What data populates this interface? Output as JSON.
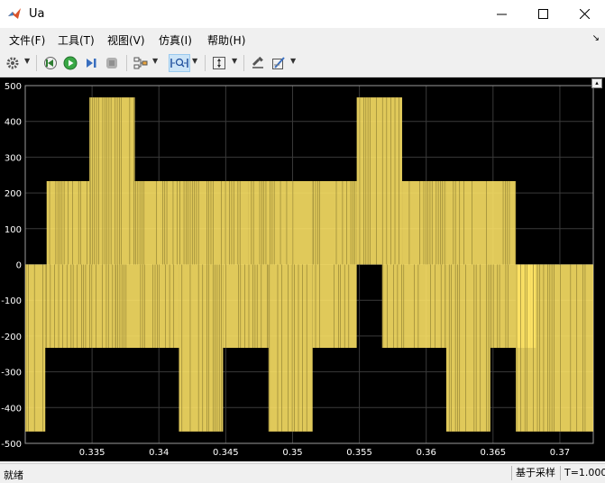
{
  "window": {
    "title": "Ua"
  },
  "menu": [
    {
      "label": "文件(F)",
      "name": "menu-file"
    },
    {
      "label": "工具(T)",
      "name": "menu-tools"
    },
    {
      "label": "视图(V)",
      "name": "menu-view"
    },
    {
      "label": "仿真(I)",
      "name": "menu-simulation"
    },
    {
      "label": "帮助(H)",
      "name": "menu-help"
    }
  ],
  "toolbar": {
    "icons": [
      "gear-icon",
      "step-back-icon",
      "run-icon",
      "step-forward-icon",
      "stop-icon",
      "signal-select-icon",
      "zoom-x-icon",
      "scale-y-icon",
      "highlight-icon",
      "style-icon"
    ]
  },
  "status": {
    "left": "就绪",
    "sample_mode": "基于采样",
    "time": "T=1.000"
  },
  "colors": {
    "trace": "#ffe566",
    "background": "#000000",
    "grid": "#3a3a3a",
    "axis_text": "#ffffff"
  },
  "chart_data": {
    "type": "line",
    "title": "",
    "xlabel": "",
    "ylabel": "",
    "xlim": [
      0.33,
      0.3725
    ],
    "ylim": [
      -500,
      500
    ],
    "x_ticks": [
      0.335,
      0.34,
      0.345,
      0.35,
      0.355,
      0.36,
      0.365,
      0.37
    ],
    "x_tick_labels": [
      "0.335",
      "0.34",
      "0.345",
      "0.35",
      "0.355",
      "0.36",
      "0.365",
      "0.37"
    ],
    "y_ticks": [
      500,
      400,
      300,
      200,
      100,
      0,
      -100,
      -200,
      -300,
      -400,
      -500
    ],
    "y_tick_labels": [
      "500",
      "400",
      "300",
      "200",
      "100",
      "0",
      "-100",
      "-200",
      "-300",
      "-400",
      "-500"
    ],
    "grid": true,
    "series": [
      {
        "color": "#ffe566",
        "description_segments": [
          {
            "x_start": 0.33,
            "x_end": 0.3315,
            "min": -467,
            "max": 0
          },
          {
            "x_start": 0.3315,
            "x_end": 0.3367,
            "min": -233,
            "max": 0
          },
          {
            "x_start": 0.3316,
            "x_end": 0.3348,
            "min": 0,
            "max": 233
          },
          {
            "x_start": 0.3348,
            "x_end": 0.3382,
            "min": 0,
            "max": 467
          },
          {
            "x_start": 0.3382,
            "x_end": 0.3415,
            "min": 0,
            "max": 233
          },
          {
            "x_start": 0.3367,
            "x_end": 0.3415,
            "min": -233,
            "max": 0
          },
          {
            "x_start": 0.3415,
            "x_end": 0.3448,
            "min": -467,
            "max": 0
          },
          {
            "x_start": 0.3448,
            "x_end": 0.3482,
            "min": -233,
            "max": 0
          },
          {
            "x_start": 0.3415,
            "x_end": 0.3467,
            "min": 0,
            "max": 233
          },
          {
            "x_start": 0.3467,
            "x_end": 0.3515,
            "min": 0,
            "max": 233
          },
          {
            "x_start": 0.3482,
            "x_end": 0.3515,
            "min": -467,
            "max": 0
          },
          {
            "x_start": 0.3515,
            "x_end": 0.3548,
            "min": -233,
            "max": 0
          },
          {
            "x_start": 0.3515,
            "x_end": 0.3548,
            "min": 0,
            "max": 233
          },
          {
            "x_start": 0.3548,
            "x_end": 0.3582,
            "min": 0,
            "max": 467
          },
          {
            "x_start": 0.3582,
            "x_end": 0.3615,
            "min": 0,
            "max": 233
          },
          {
            "x_start": 0.3567,
            "x_end": 0.3615,
            "min": -233,
            "max": 0
          },
          {
            "x_start": 0.3615,
            "x_end": 0.3648,
            "min": -467,
            "max": 0
          },
          {
            "x_start": 0.3648,
            "x_end": 0.3682,
            "min": -233,
            "max": 0
          },
          {
            "x_start": 0.3615,
            "x_end": 0.3667,
            "min": 0,
            "max": 233
          },
          {
            "x_start": 0.3667,
            "x_end": 0.3725,
            "min": -467,
            "max": 0
          }
        ]
      }
    ]
  }
}
